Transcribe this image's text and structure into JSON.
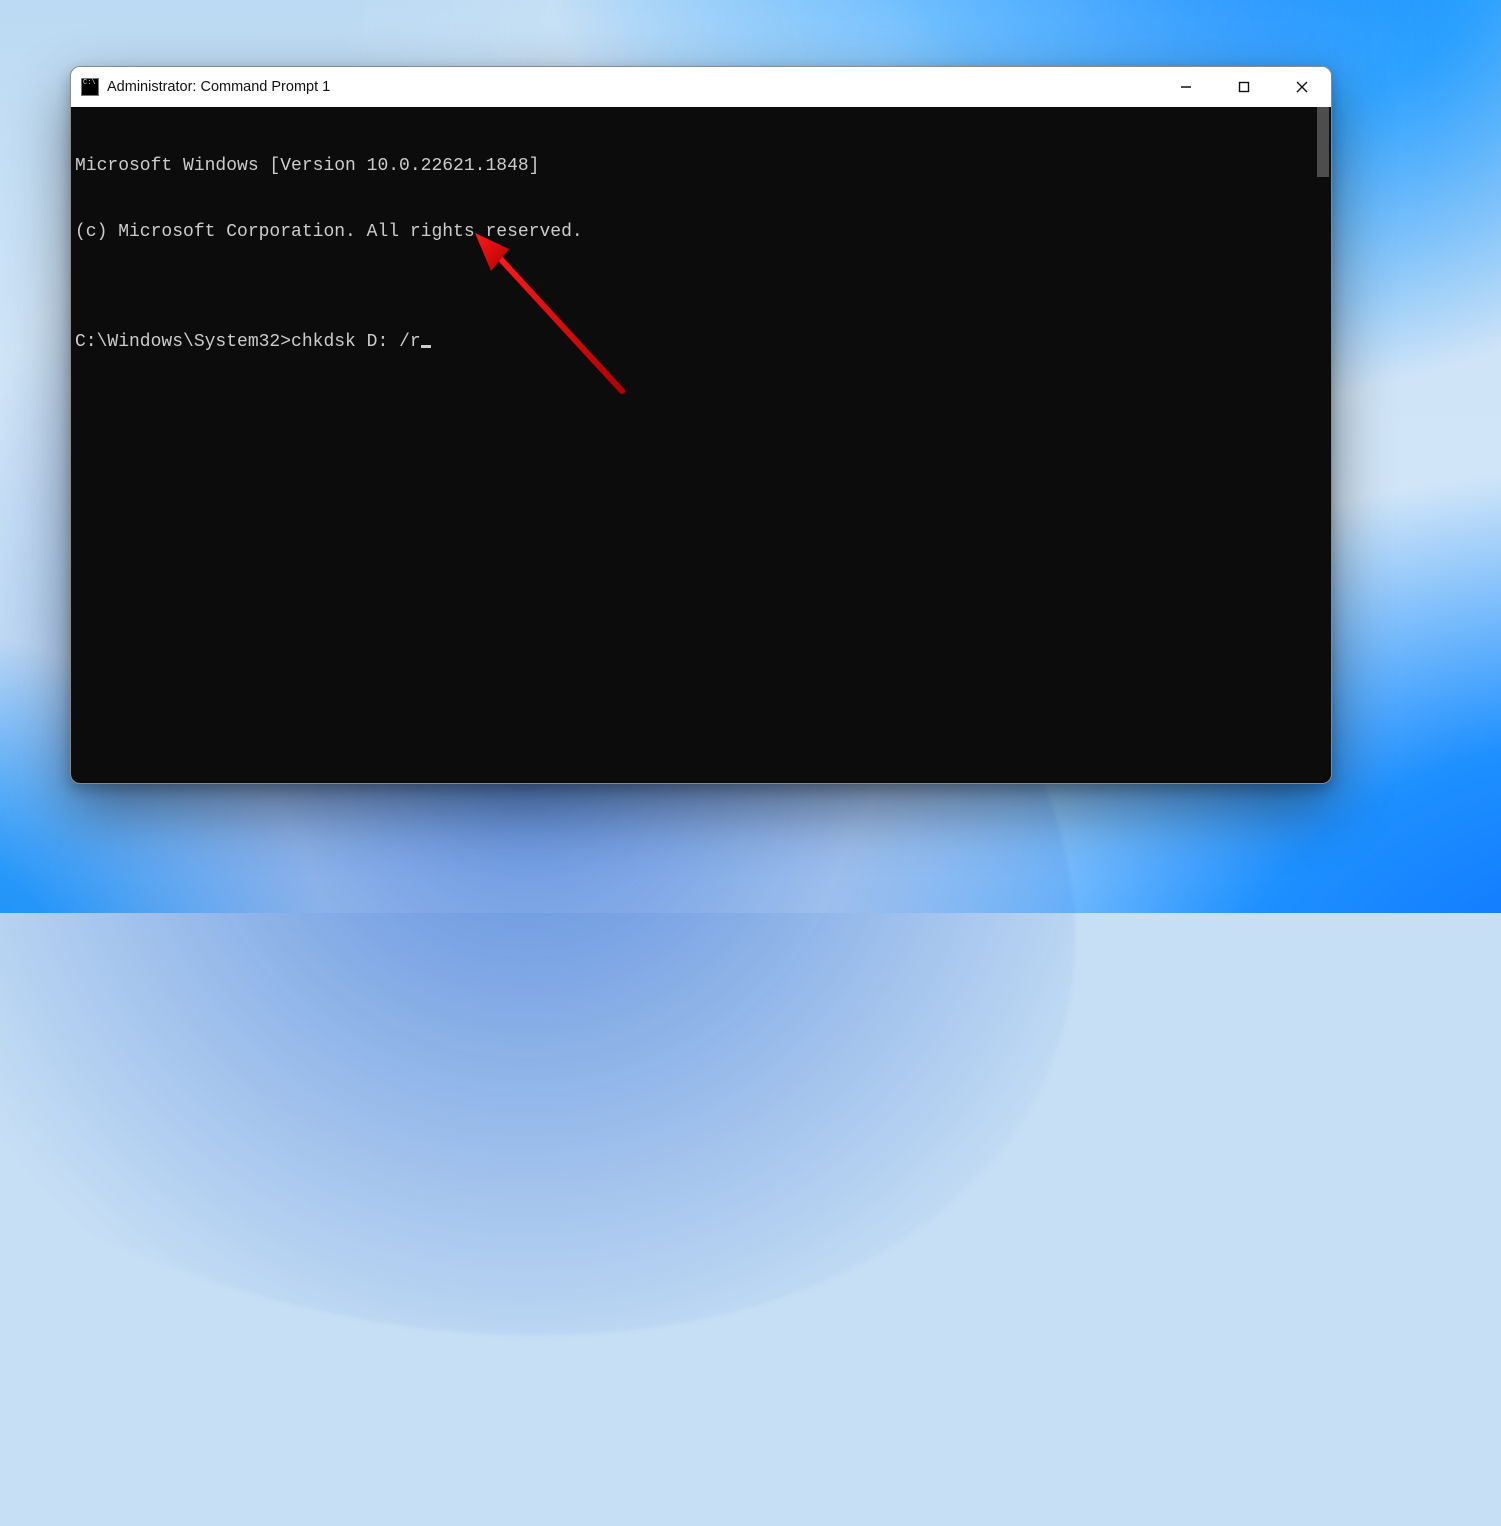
{
  "window": {
    "title": "Administrator: Command Prompt 1"
  },
  "terminal": {
    "line1": "Microsoft Windows [Version 10.0.22621.1848]",
    "line2": "(c) Microsoft Corporation. All rights reserved.",
    "blank": "",
    "prompt": "C:\\Windows\\System32>",
    "command": "chkdsk D: /r"
  }
}
